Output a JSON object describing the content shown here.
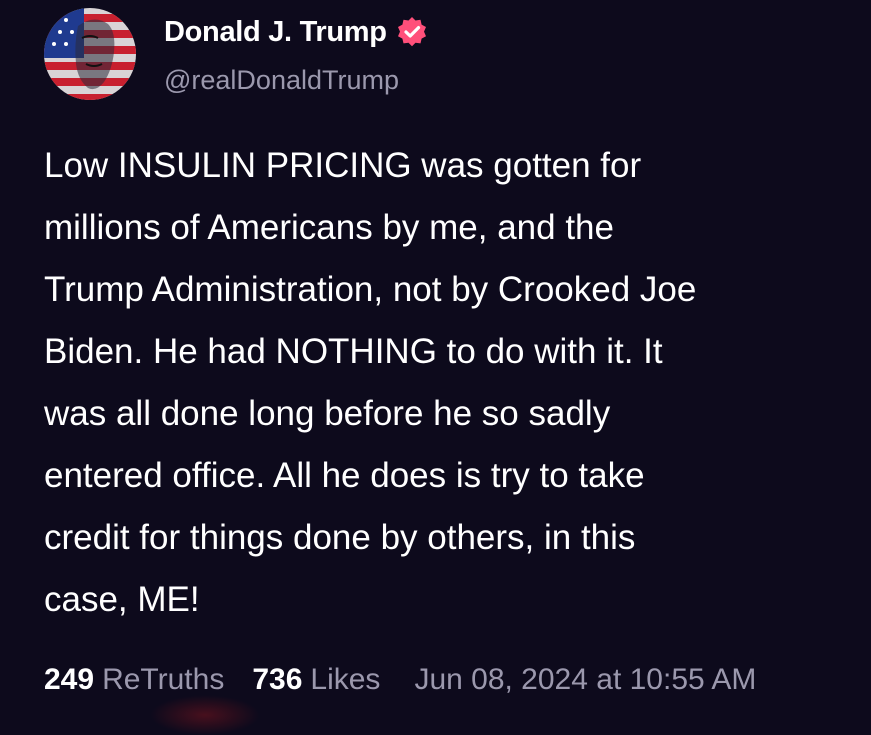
{
  "author": {
    "name": "Donald J. Trump",
    "handle": "@realDonaldTrump",
    "verified_icon": "verified-badge-icon",
    "badge_color": "#ff4f7a"
  },
  "post": {
    "lines": [
      "Low INSULIN PRICING was gotten for",
      "millions of Americans by me, and the",
      "Trump Administration, not by Crooked Joe",
      "Biden. He had NOTHING to do with it. It",
      "was all done long before he so sadly",
      "entered office. All he does is try to take",
      "credit for things done by others, in this",
      "case, ME!"
    ]
  },
  "stats": {
    "retruths_count": "249",
    "retruths_label": "ReTruths",
    "likes_count": "736",
    "likes_label": "Likes",
    "timestamp": "Jun 08, 2024 at 10:55 AM"
  },
  "colors": {
    "background": "#0d0a1c",
    "text": "#ffffff",
    "muted": "#9b98ad"
  }
}
